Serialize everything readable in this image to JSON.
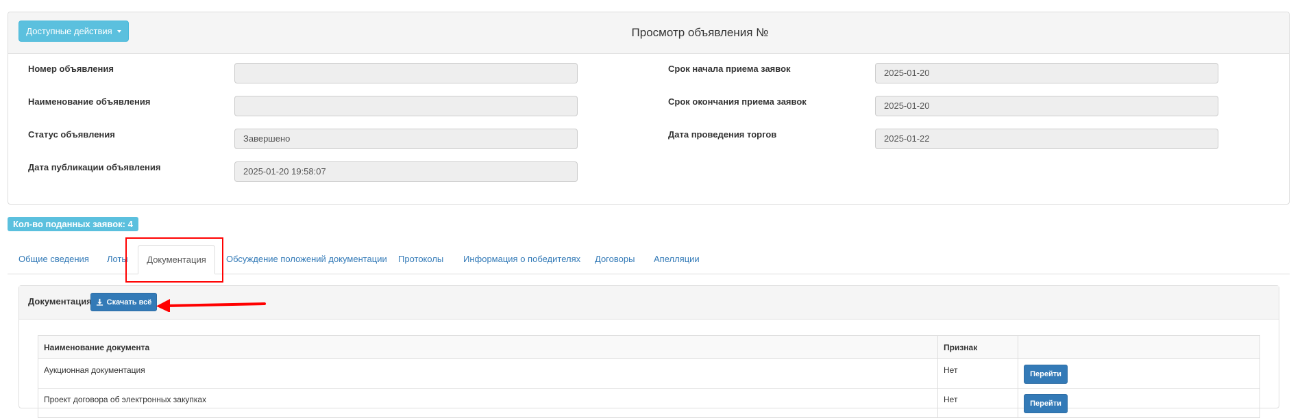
{
  "header": {
    "actions_button": "Доступные действия",
    "title": "Просмотр объявления №"
  },
  "fields_left": [
    {
      "label": "Номер объявления",
      "value": ""
    },
    {
      "label": "Наименование объявления",
      "value": ""
    },
    {
      "label": "Статус объявления",
      "value": "Завершено"
    },
    {
      "label": "Дата публикации объявления",
      "value": "2025-01-20 19:58:07"
    }
  ],
  "fields_right": [
    {
      "label": "Срок начала приема заявок",
      "value": "2025-01-20"
    },
    {
      "label": "Срок окончания приема заявок",
      "value": "2025-01-20"
    },
    {
      "label": "Дата проведения торгов",
      "value": "2025-01-22"
    }
  ],
  "applications_badge": "Кол-во поданных заявок: 4",
  "tabs": [
    {
      "label": "Общие сведения",
      "active": false
    },
    {
      "label": "Лоты",
      "active": false
    },
    {
      "label": "Документация",
      "active": true
    },
    {
      "label": "Обсуждение положений документации",
      "active": false
    },
    {
      "label": "Протоколы",
      "active": false
    },
    {
      "label": "Информация о победителях",
      "active": false
    },
    {
      "label": "Договоры",
      "active": false
    },
    {
      "label": "Апелляции",
      "active": false
    }
  ],
  "documentation": {
    "heading": "Документация",
    "download_all_button": "Скачать всё",
    "table": {
      "columns": [
        "Наименование документа",
        "Признак",
        ""
      ],
      "rows": [
        {
          "name": "Аукционная документация",
          "flag": "Нет",
          "action": "Перейти"
        },
        {
          "name": "Проект договора об электронных закупках",
          "flag": "Нет",
          "action": "Перейти"
        }
      ]
    }
  },
  "colors": {
    "info": "#5bc0de",
    "primary": "#337ab7",
    "annotation": "#ff0000"
  }
}
